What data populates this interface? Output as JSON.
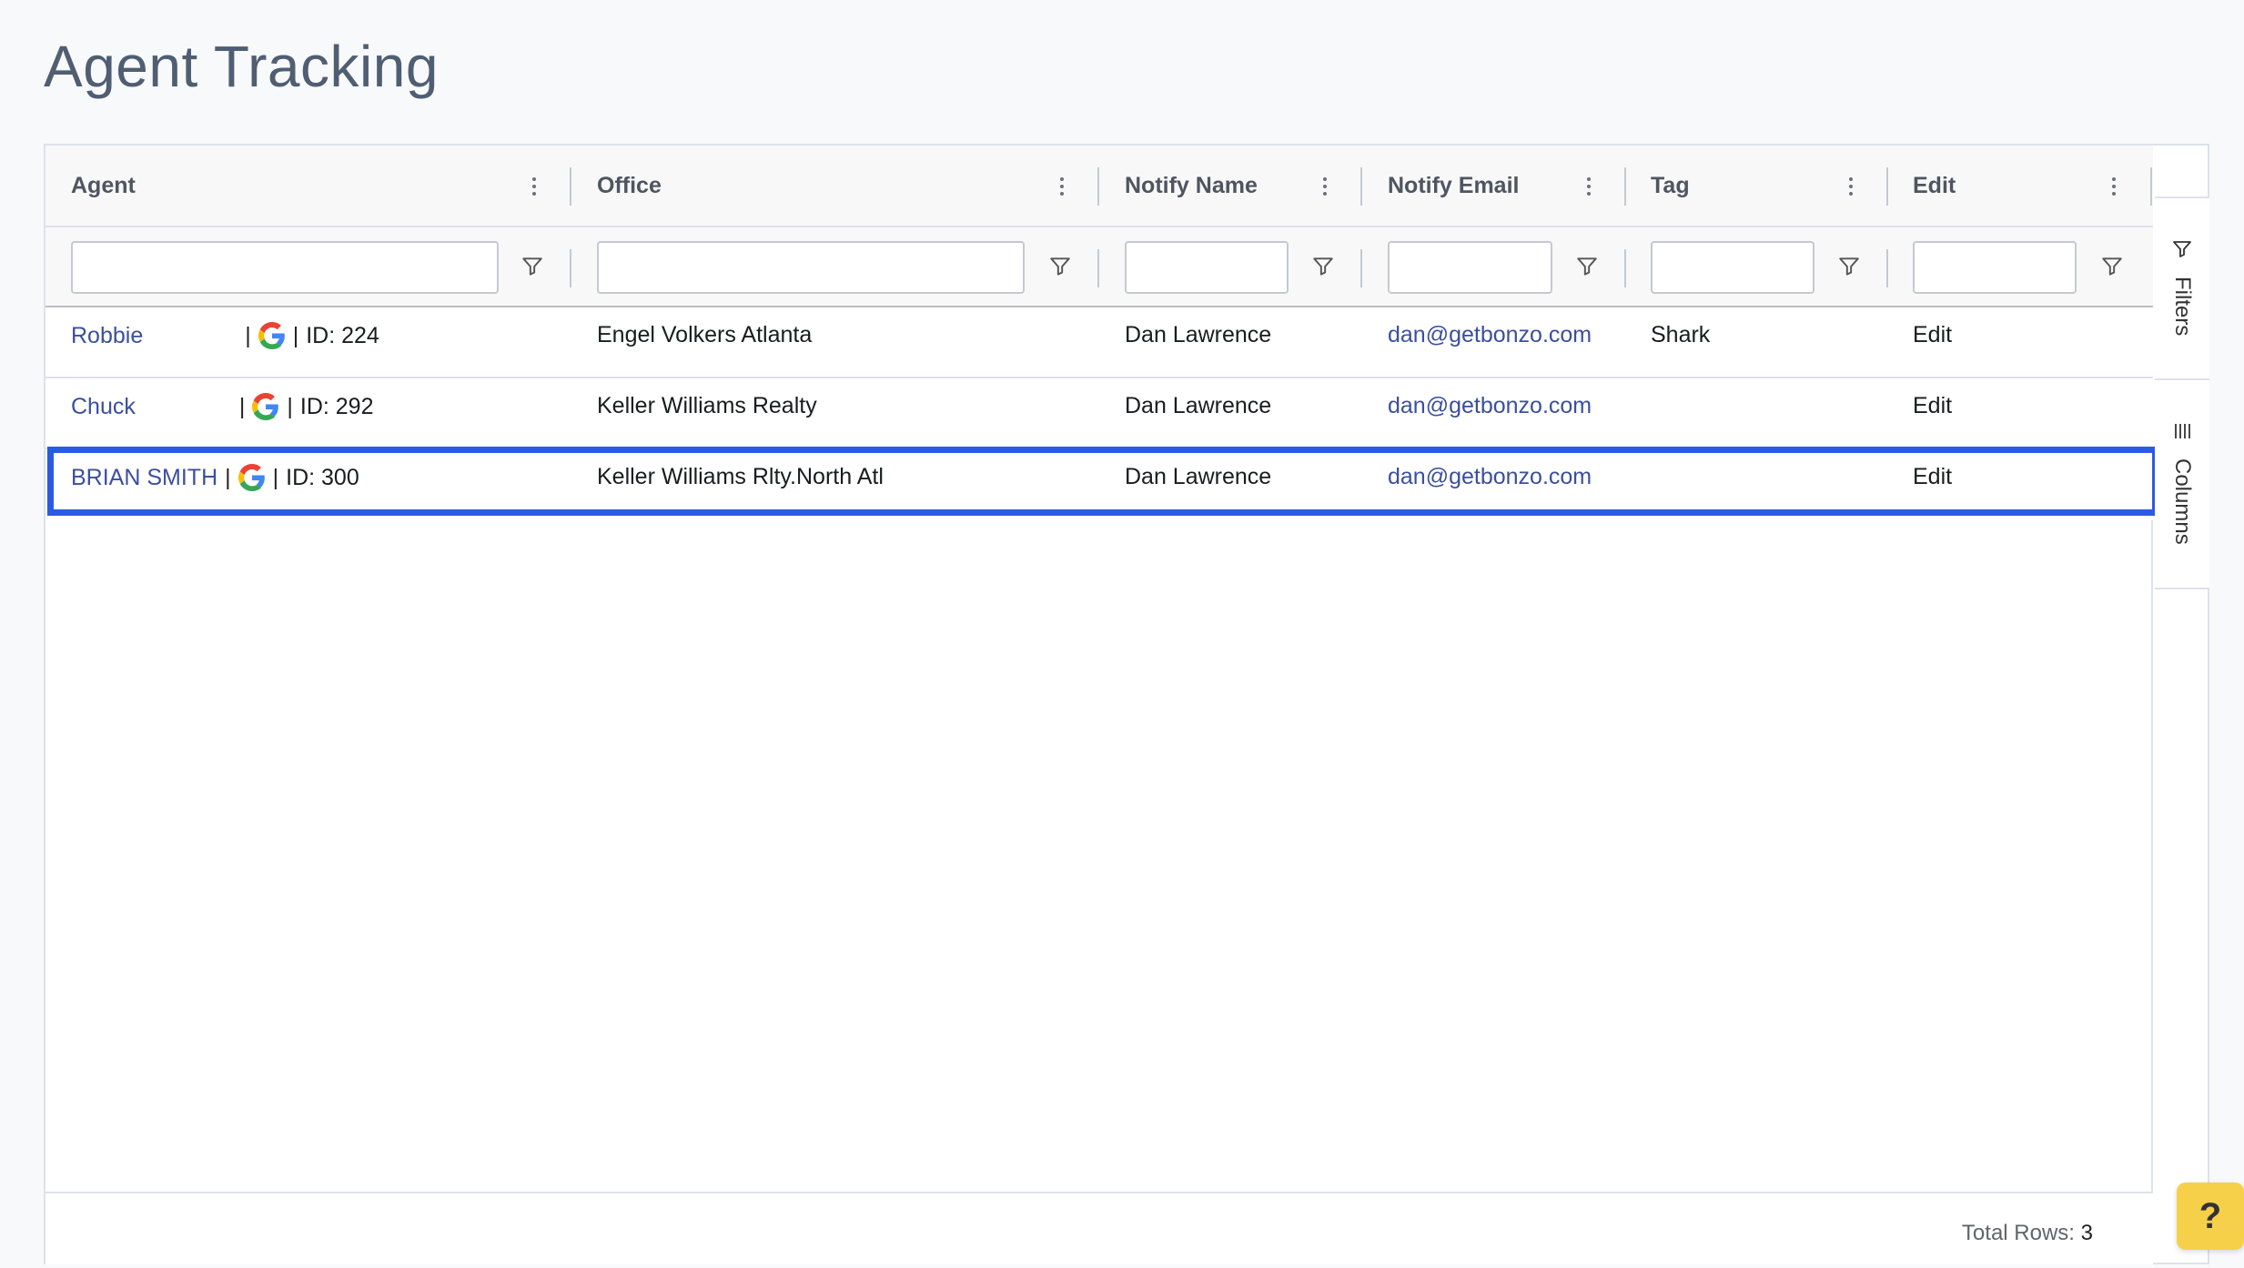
{
  "page": {
    "title": "Agent Tracking"
  },
  "columns": [
    {
      "label": "Agent"
    },
    {
      "label": "Office"
    },
    {
      "label": "Notify Name"
    },
    {
      "label": "Notify Email"
    },
    {
      "label": "Tag"
    },
    {
      "label": "Edit"
    }
  ],
  "filters": {
    "values": [
      "",
      "",
      "",
      "",
      "",
      ""
    ]
  },
  "rows": [
    {
      "agent": "Robbie",
      "id": "ID: 224",
      "office": "Engel Volkers Atlanta",
      "notify_name": "Dan Lawrence",
      "notify_email": "dan@getbonzo.com",
      "tag": "Shark",
      "edit": "Edit"
    },
    {
      "agent": "Chuck",
      "id": "ID: 292",
      "office": "Keller Williams Realty",
      "notify_name": "Dan Lawrence",
      "notify_email": "dan@getbonzo.com",
      "tag": "",
      "edit": "Edit"
    },
    {
      "agent": "BRIAN SMITH",
      "id": "ID: 300",
      "office": "Keller Williams Rlty.North Atl",
      "notify_name": "Dan Lawrence",
      "notify_email": "dan@getbonzo.com",
      "tag": "",
      "edit": "Edit"
    }
  ],
  "side_panel": {
    "filters_label": "Filters",
    "columns_label": "Columns"
  },
  "footer": {
    "total_rows_label": "Total Rows:",
    "total_rows_value": "3"
  },
  "help": {
    "label": "?"
  },
  "colors": {
    "highlight": "#2c5be3",
    "link": "#3b4f9e",
    "help_bg": "#f7d04a"
  }
}
